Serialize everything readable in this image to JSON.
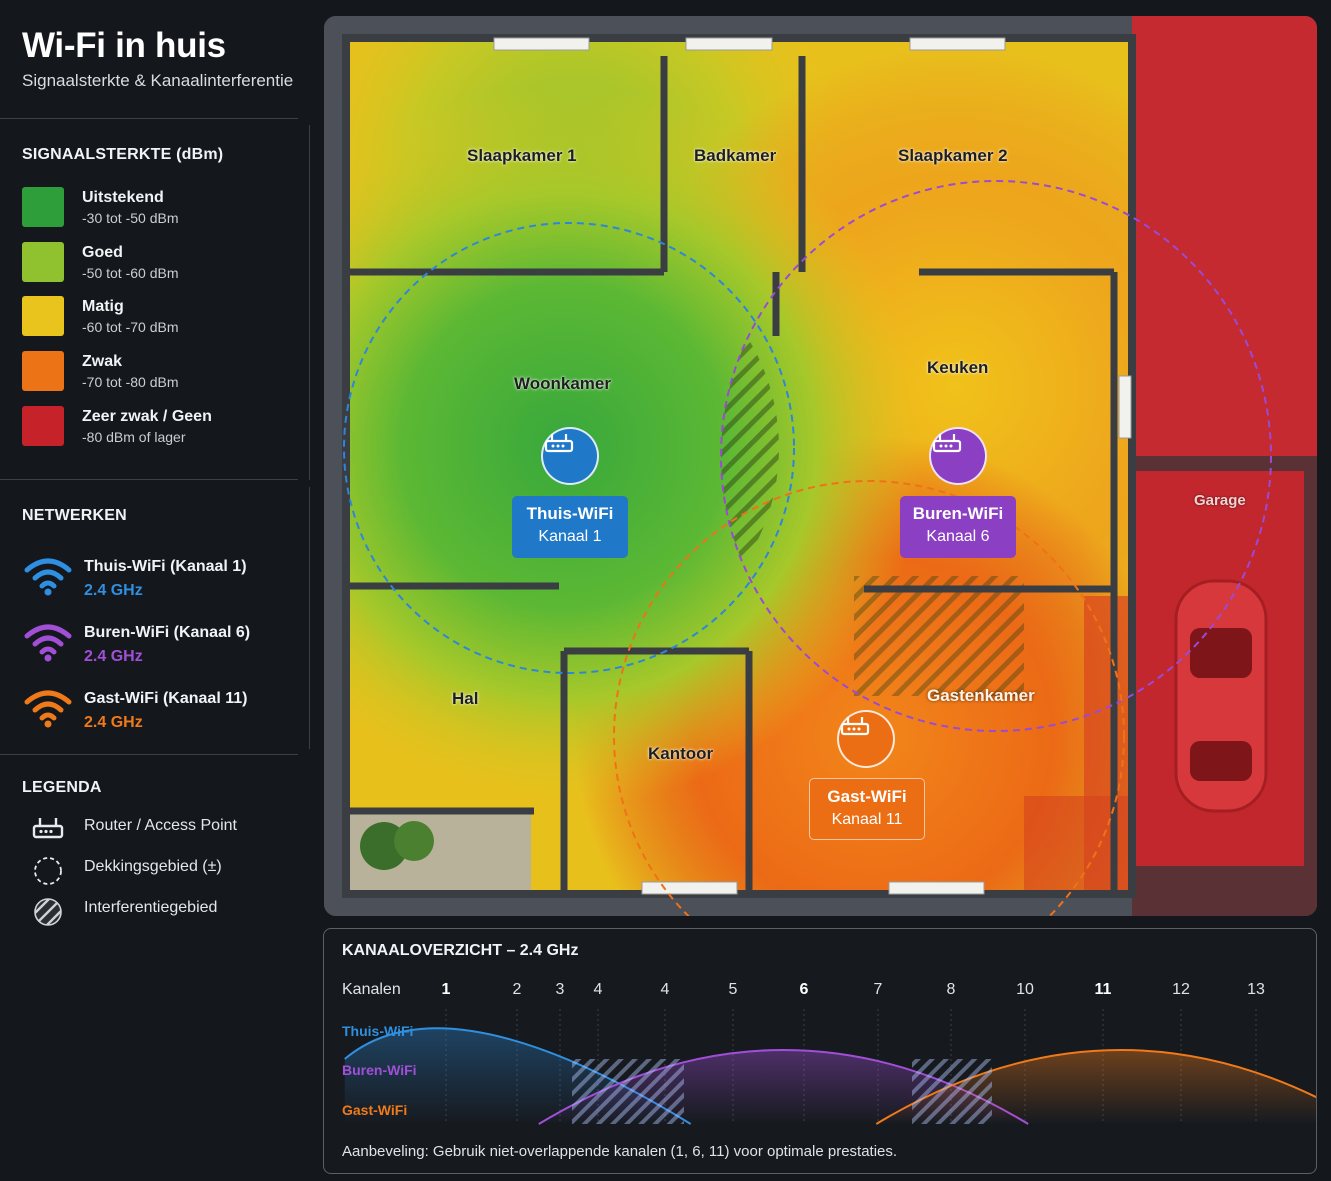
{
  "header": {
    "title": "Wi-Fi in huis",
    "subtitle": "Signaalsterkte & Kanaalinterferentie"
  },
  "signal_legend": {
    "heading": "SIGNAALSTERKTE (dBm)",
    "items": [
      {
        "label": "Uitstekend",
        "range": "-30 tot -50 dBm",
        "color": "#2e9e3a"
      },
      {
        "label": "Goed",
        "range": "-50 tot -60 dBm",
        "color": "#8fc22e"
      },
      {
        "label": "Matig",
        "range": "-60 tot -70 dBm",
        "color": "#e8c41c"
      },
      {
        "label": "Zwak",
        "range": "-70 tot -80 dBm",
        "color": "#ec7316"
      },
      {
        "label": "Zeer zwak / Geen",
        "range": "-80 dBm of lager",
        "color": "#c5222a"
      }
    ]
  },
  "networks": {
    "heading": "NETWERKEN",
    "items": [
      {
        "name": "Thuis-WiFi (Kanaal 1)",
        "band": "2.4 GHz",
        "color": "#2f8fe0",
        "icon": "wifi-icon"
      },
      {
        "name": "Buren-WiFi (Kanaal 6)",
        "band": "2.4 GHz",
        "color": "#a24fd8",
        "icon": "wifi-icon"
      },
      {
        "name": "Gast-WiFi (Kanaal 11)",
        "band": "2.4 GHz",
        "color": "#f07a1a",
        "icon": "wifi-icon"
      }
    ]
  },
  "key": {
    "heading": "LEGENDA",
    "items": [
      {
        "label": "Router / Access Point",
        "icon": "router-icon"
      },
      {
        "label": "Dekkingsgebied (±)",
        "icon": "dashed-circle-icon"
      },
      {
        "label": "Interferentiegebied",
        "icon": "hatch-icon"
      }
    ]
  },
  "floorplan": {
    "rooms": [
      "Slaapkamer 1",
      "Badkamer",
      "Slaapkamer 2",
      "Woonkamer",
      "Keuken",
      "Hal",
      "Kantoor",
      "Gastenkamer",
      "Garage"
    ],
    "routers": [
      {
        "name": "Thuis-WiFi",
        "channel": "Kanaal 1",
        "color": "#1f78c8"
      },
      {
        "name": "Buren-WiFi",
        "channel": "Kanaal 6",
        "color": "#8b3fc2"
      },
      {
        "name": "Gast-WiFi",
        "channel": "Kanaal 11",
        "color": "#ec6e14"
      }
    ]
  },
  "channel_overview": {
    "title": "KANAALOVERZICHT – 2.4 GHz",
    "axis_label": "Kanalen",
    "channels": [
      "1",
      "2",
      "3",
      "4",
      "4",
      "5",
      "6",
      "7",
      "8",
      "10",
      "11",
      "12",
      "13"
    ],
    "bold_channels": [
      "1",
      "6",
      "11"
    ],
    "series": [
      {
        "name": "Thuis-WiFi",
        "center": 1,
        "color": "#2f8fe0"
      },
      {
        "name": "Buren-WiFi",
        "center": 6,
        "color": "#a24fd8"
      },
      {
        "name": "Gast-WiFi",
        "center": 11,
        "color": "#f07a1a"
      }
    ],
    "note": "Aanbeveling: Gebruik niet-overlappende kanalen (1, 6, 11) voor optimale prestaties."
  }
}
